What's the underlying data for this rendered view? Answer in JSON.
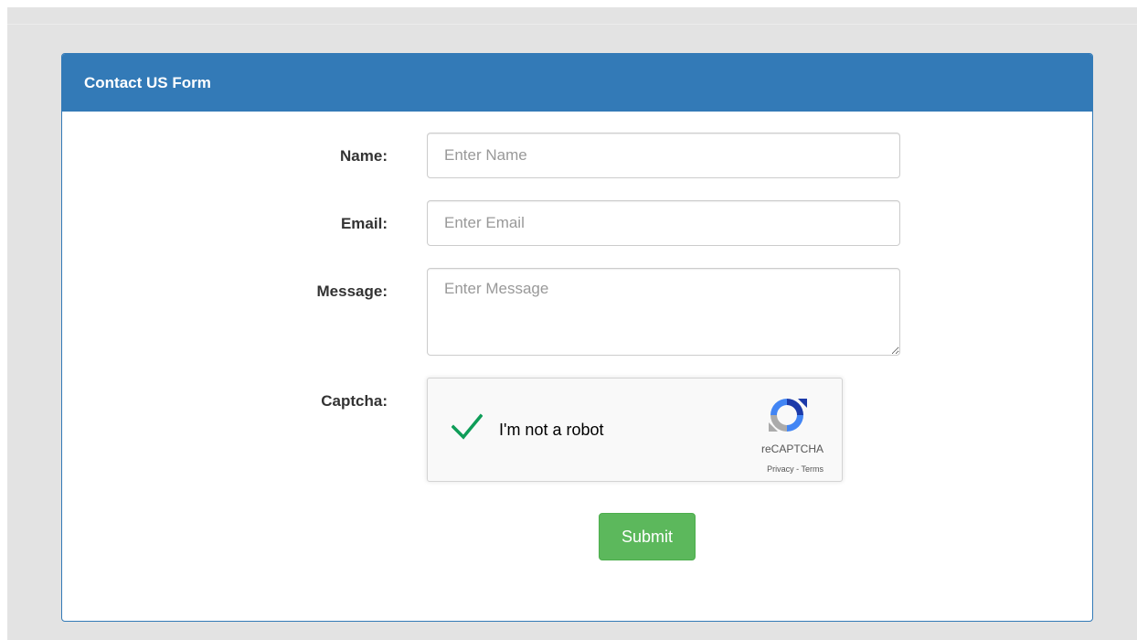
{
  "form": {
    "title": "Contact US Form",
    "name": {
      "label": "Name:",
      "placeholder": "Enter Name",
      "value": ""
    },
    "email": {
      "label": "Email:",
      "placeholder": "Enter Email",
      "value": ""
    },
    "message": {
      "label": "Message:",
      "placeholder": "Enter Message",
      "value": ""
    },
    "captcha": {
      "label": "Captcha:",
      "checkbox_text": "I'm not a robot",
      "checked": true,
      "brand": "reCAPTCHA",
      "links": "Privacy - Terms"
    },
    "submit_label": "Submit"
  },
  "colors": {
    "panel_header": "#337ab7",
    "submit_button": "#5cb85c",
    "check": "#0f9d58",
    "page_background": "#e3e3e3"
  },
  "icons": {
    "captcha_check": "check-icon",
    "captcha_logo": "recaptcha-logo-icon"
  }
}
